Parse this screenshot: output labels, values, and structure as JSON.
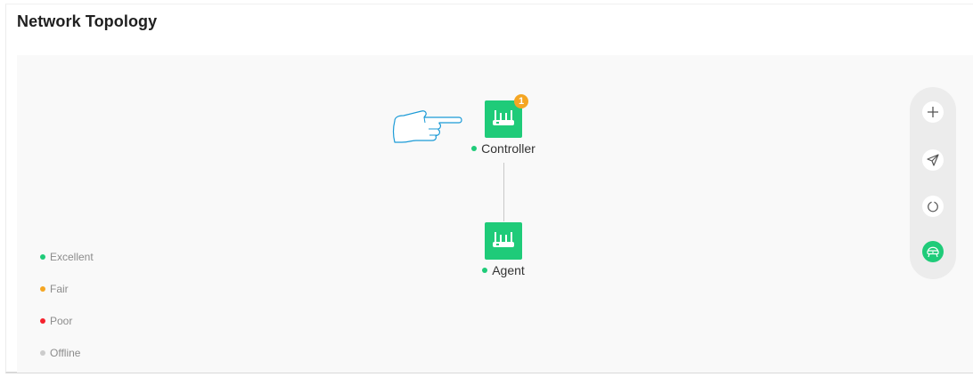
{
  "page": {
    "title": "Network Topology"
  },
  "topology": {
    "controller": {
      "label": "Controller",
      "status": "excellent",
      "badge_count": "1"
    },
    "agent": {
      "label": "Agent",
      "status": "excellent"
    }
  },
  "legend": {
    "items": [
      {
        "label": "Excellent",
        "color": "#1fcb79"
      },
      {
        "label": "Fair",
        "color": "#f5a623"
      },
      {
        "label": "Poor",
        "color": "#f5222d"
      },
      {
        "label": "Offline",
        "color": "#cccccc"
      }
    ]
  },
  "toolbar": {
    "buttons": [
      {
        "icon": "plus-icon"
      },
      {
        "icon": "send-icon"
      },
      {
        "icon": "power-icon"
      },
      {
        "icon": "router-icon",
        "active": true
      }
    ]
  },
  "colors": {
    "accent": "#1fcb79",
    "badge": "#f5a623",
    "hand_outline": "#1a9ad6"
  }
}
